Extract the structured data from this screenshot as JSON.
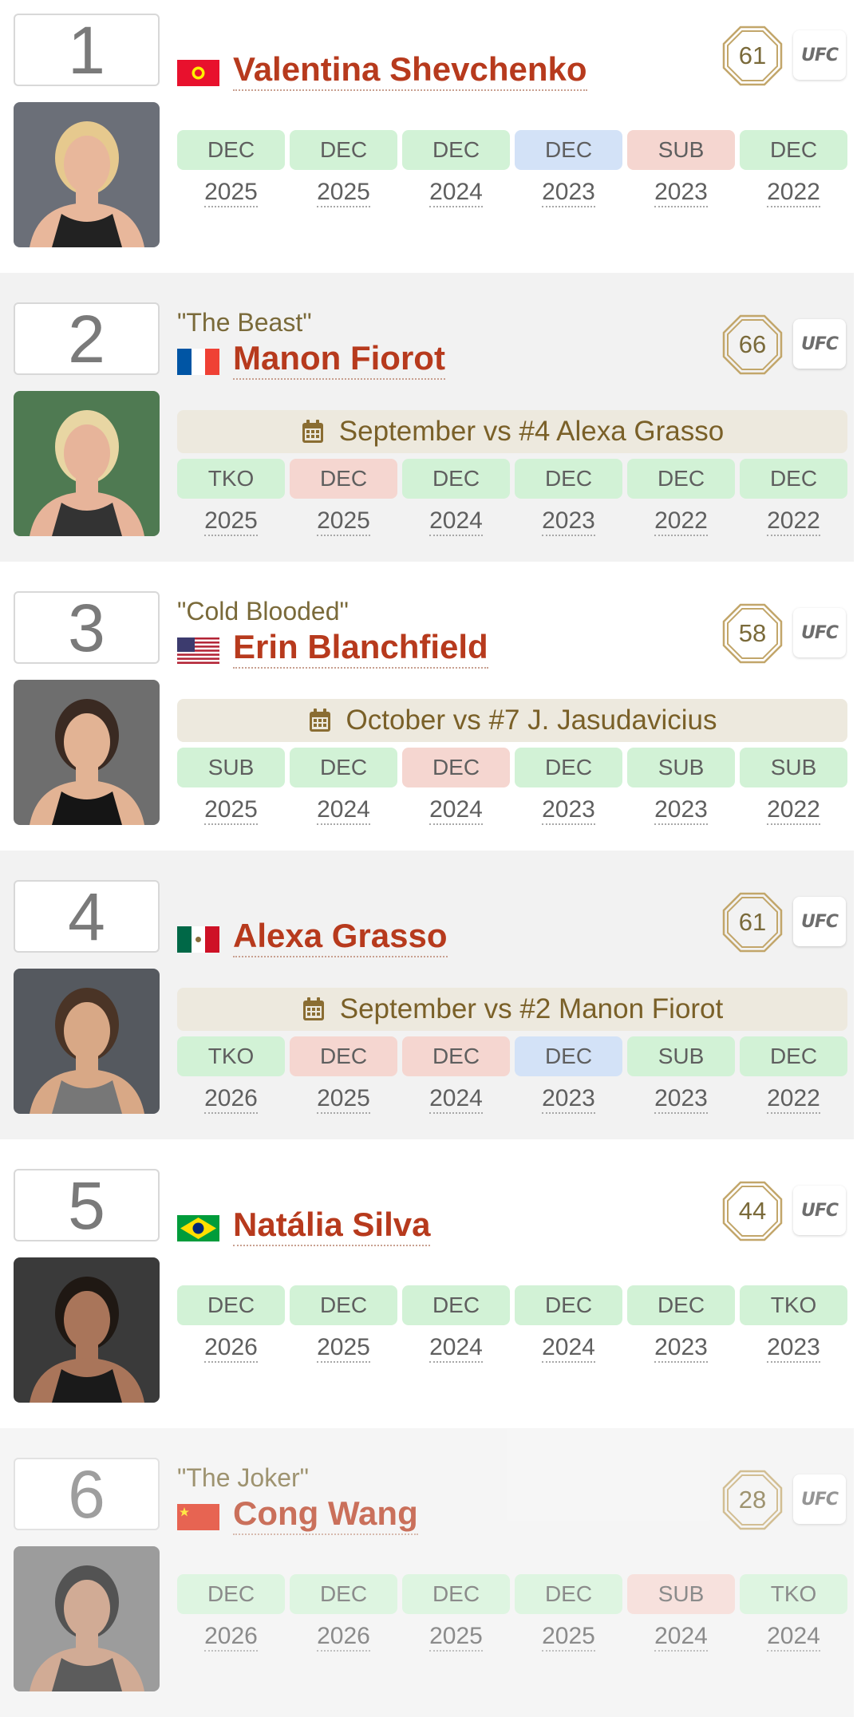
{
  "fighters": [
    {
      "rank": "1",
      "nickname": "",
      "name": "Valentina Shevchenko",
      "country": "kyrgyzstan",
      "ranking_badge": "61",
      "org": "UFC",
      "next_fight": "",
      "background": "white",
      "fights": [
        {
          "method": "DEC",
          "year": "2025",
          "result": "win"
        },
        {
          "method": "DEC",
          "year": "2025",
          "result": "win"
        },
        {
          "method": "DEC",
          "year": "2024",
          "result": "win"
        },
        {
          "method": "DEC",
          "year": "2023",
          "result": "nc"
        },
        {
          "method": "SUB",
          "year": "2023",
          "result": "loss"
        },
        {
          "method": "DEC",
          "year": "2022",
          "result": "win"
        }
      ]
    },
    {
      "rank": "2",
      "nickname": "\"The Beast\"",
      "name": "Manon Fiorot",
      "country": "france",
      "ranking_badge": "66",
      "org": "UFC",
      "next_fight": "September vs #4 Alexa Grasso",
      "background": "gray",
      "fights": [
        {
          "method": "TKO",
          "year": "2025",
          "result": "win"
        },
        {
          "method": "DEC",
          "year": "2025",
          "result": "loss"
        },
        {
          "method": "DEC",
          "year": "2024",
          "result": "win"
        },
        {
          "method": "DEC",
          "year": "2023",
          "result": "win"
        },
        {
          "method": "DEC",
          "year": "2022",
          "result": "win"
        },
        {
          "method": "DEC",
          "year": "2022",
          "result": "win"
        }
      ]
    },
    {
      "rank": "3",
      "nickname": "\"Cold Blooded\"",
      "name": "Erin Blanchfield",
      "country": "usa",
      "ranking_badge": "58",
      "org": "UFC",
      "next_fight": "October vs #7 J. Jasudavicius",
      "background": "white",
      "fights": [
        {
          "method": "SUB",
          "year": "2025",
          "result": "win"
        },
        {
          "method": "DEC",
          "year": "2024",
          "result": "win"
        },
        {
          "method": "DEC",
          "year": "2024",
          "result": "loss"
        },
        {
          "method": "DEC",
          "year": "2023",
          "result": "win"
        },
        {
          "method": "SUB",
          "year": "2023",
          "result": "win"
        },
        {
          "method": "SUB",
          "year": "2022",
          "result": "win"
        }
      ]
    },
    {
      "rank": "4",
      "nickname": "",
      "name": "Alexa Grasso",
      "country": "mexico",
      "ranking_badge": "61",
      "org": "UFC",
      "next_fight": "September vs #2 Manon Fiorot",
      "background": "gray",
      "fights": [
        {
          "method": "TKO",
          "year": "2026",
          "result": "win"
        },
        {
          "method": "DEC",
          "year": "2025",
          "result": "loss"
        },
        {
          "method": "DEC",
          "year": "2024",
          "result": "loss"
        },
        {
          "method": "DEC",
          "year": "2023",
          "result": "nc"
        },
        {
          "method": "SUB",
          "year": "2023",
          "result": "win"
        },
        {
          "method": "DEC",
          "year": "2022",
          "result": "win"
        }
      ]
    },
    {
      "rank": "5",
      "nickname": "",
      "name": "Natália Silva",
      "country": "brazil",
      "ranking_badge": "44",
      "org": "UFC",
      "next_fight": "",
      "background": "white",
      "fights": [
        {
          "method": "DEC",
          "year": "2026",
          "result": "win"
        },
        {
          "method": "DEC",
          "year": "2025",
          "result": "win"
        },
        {
          "method": "DEC",
          "year": "2024",
          "result": "win"
        },
        {
          "method": "DEC",
          "year": "2024",
          "result": "win"
        },
        {
          "method": "DEC",
          "year": "2023",
          "result": "win"
        },
        {
          "method": "TKO",
          "year": "2023",
          "result": "win"
        }
      ]
    },
    {
      "rank": "6",
      "nickname": "\"The Joker\"",
      "name": "Cong Wang",
      "country": "china",
      "ranking_badge": "28",
      "org": "UFC",
      "next_fight": "",
      "background": "gray",
      "faded": true,
      "fights": [
        {
          "method": "DEC",
          "year": "2026",
          "result": "win"
        },
        {
          "method": "DEC",
          "year": "2026",
          "result": "win"
        },
        {
          "method": "DEC",
          "year": "2025",
          "result": "win"
        },
        {
          "method": "DEC",
          "year": "2025",
          "result": "win"
        },
        {
          "method": "SUB",
          "year": "2024",
          "result": "loss"
        },
        {
          "method": "TKO",
          "year": "2024",
          "result": "win"
        }
      ]
    }
  ],
  "colors": {
    "win": "#d2f2d6",
    "loss": "#f5d6d0",
    "no_contest": "#d3e2f7",
    "name": "#b73a1d",
    "accent_gold": "#c2a66a",
    "next_fight_bg": "#ede9de"
  },
  "icons": {
    "next_fight": "calendar-icon",
    "ranking": "octagon-icon"
  }
}
